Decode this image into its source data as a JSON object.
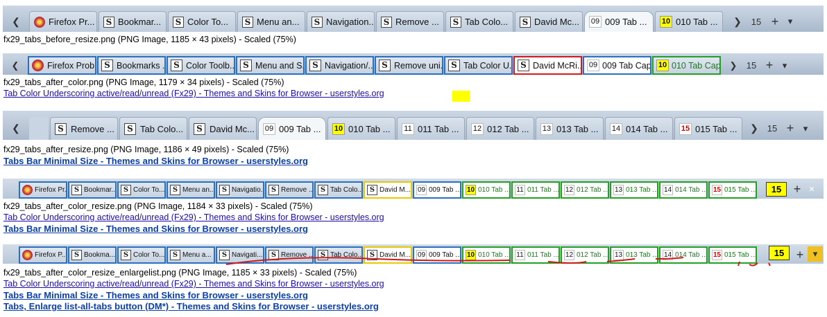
{
  "screens": [
    {
      "caption": "fx29_tabs_before_resize.png (PNG Image, 1185 × 43 pixels) - Scaled (75%)",
      "count": "15",
      "tabs": [
        {
          "label": "Firefox Pr...",
          "icon": "firefox-icon"
        },
        {
          "label": "Bookmar...",
          "icon": "userstyles-s-icon"
        },
        {
          "label": "Color To...",
          "icon": "userstyles-s-icon"
        },
        {
          "label": "Menu an...",
          "icon": "userstyles-s-icon"
        },
        {
          "label": "Navigation...",
          "icon": "userstyles-s-icon"
        },
        {
          "label": "Remove ...",
          "icon": "userstyles-s-icon"
        },
        {
          "label": "Tab Colo...",
          "icon": "userstyles-s-icon"
        },
        {
          "label": "David Mc...",
          "icon": "userstyles-s-icon"
        },
        {
          "label": "009 Tab ...",
          "num": "09"
        },
        {
          "label": "010 Tab ...",
          "num": "10"
        }
      ]
    },
    {
      "caption": "fx29_tabs_after_color.png (PNG Image, 1179 × 34 pixels) - Scaled (75%)",
      "link": "Tab Color Underscoring active/read/unread (Fx29) - Themes and Skins for Browser - userstyles.org",
      "count": "15",
      "tabs": [
        {
          "label": "Firefox Prob...",
          "icon": "firefox-icon"
        },
        {
          "label": "Bookmarks ...",
          "icon": "userstyles-s-icon"
        },
        {
          "label": "Color Toolb...",
          "icon": "userstyles-s-icon"
        },
        {
          "label": "Menu and S...",
          "icon": "userstyles-s-icon"
        },
        {
          "label": "Navigation/...",
          "icon": "userstyles-s-icon"
        },
        {
          "label": "Remove uni...",
          "icon": "userstyles-s-icon"
        },
        {
          "label": "Tab Color U...",
          "icon": "userstyles-s-icon"
        },
        {
          "label": "David McRi...",
          "icon": "userstyles-s-icon"
        },
        {
          "label": "009 Tab Cap...",
          "num": "09"
        },
        {
          "label": "010 Tab Cap...",
          "num": "10"
        }
      ]
    },
    {
      "caption": "fx29_tabs_after_resize.png (PNG Image, 1186 × 49 pixels) - Scaled (75%)",
      "link": "Tabs Bar Minimal Size - Themes and Skins for Browser - userstyles.org",
      "count": "15",
      "tabs": [
        {
          "label": "Remove ...",
          "icon": "userstyles-s-icon"
        },
        {
          "label": "Tab Colo...",
          "icon": "userstyles-s-icon"
        },
        {
          "label": "David Mc...",
          "icon": "userstyles-s-icon"
        },
        {
          "label": "009 Tab ...",
          "num": "09"
        },
        {
          "label": "010 Tab ...",
          "num": "10"
        },
        {
          "label": "011 Tab ...",
          "num": "11"
        },
        {
          "label": "012 Tab ...",
          "num": "12"
        },
        {
          "label": "013 Tab ...",
          "num": "13"
        },
        {
          "label": "014 Tab ...",
          "num": "14"
        },
        {
          "label": "015 Tab ...",
          "num": "15"
        }
      ]
    },
    {
      "caption": "fx29_tabs_after_color_resize.png (PNG Image, 1184 × 33 pixels) - Scaled (75%)",
      "links": [
        "Tab Color Underscoring active/read/unread (Fx29) - Themes and Skins for Browser - userstyles.org",
        "Tabs Bar Minimal Size - Themes and Skins for Browser - userstyles.org"
      ],
      "count": "15",
      "tabs": [
        {
          "label": "Firefox Pr...",
          "icon": "firefox-icon"
        },
        {
          "label": "Bookmar...",
          "icon": "userstyles-s-icon"
        },
        {
          "label": "Color To...",
          "icon": "userstyles-s-icon"
        },
        {
          "label": "Menu an...",
          "icon": "userstyles-s-icon"
        },
        {
          "label": "Navigatio...",
          "icon": "userstyles-s-icon"
        },
        {
          "label": "Remove ...",
          "icon": "userstyles-s-icon"
        },
        {
          "label": "Tab Colo...",
          "icon": "userstyles-s-icon"
        },
        {
          "label": "David M...",
          "icon": "userstyles-s-icon"
        },
        {
          "label": "009 Tab ...",
          "num": "09"
        },
        {
          "label": "010 Tab ...",
          "num": "10"
        },
        {
          "label": "011 Tab ...",
          "num": "11"
        },
        {
          "label": "012 Tab ...",
          "num": "12"
        },
        {
          "label": "013 Tab ...",
          "num": "13"
        },
        {
          "label": "014 Tab ...",
          "num": "14"
        },
        {
          "label": "015 Tab ...",
          "num": "15"
        }
      ]
    },
    {
      "caption": "fx29_tabs_after_color_resize_enlargelist.png (PNG Image, 1185 × 33 pixels) - Scaled (75%)",
      "links": [
        "Tab Color Underscoring active/read/unread (Fx29) - Themes and Skins for Browser - userstyles.org",
        "Tabs Bar Minimal Size - Themes and Skins for Browser - userstyles.org",
        "Tabs, Enlarge list-all-tabs button (DM*) - Themes and Skins for Browser - userstyles.org"
      ],
      "count": "15",
      "tabs": [
        {
          "label": "Firefox P...",
          "icon": "firefox-icon"
        },
        {
          "label": "Bookma...",
          "icon": "userstyles-s-icon"
        },
        {
          "label": "Color To...",
          "icon": "userstyles-s-icon"
        },
        {
          "label": "Menu a...",
          "icon": "userstyles-s-icon"
        },
        {
          "label": "Navigati...",
          "icon": "userstyles-s-icon"
        },
        {
          "label": "Remove ...",
          "icon": "userstyles-s-icon"
        },
        {
          "label": "Tab Colo...",
          "icon": "userstyles-s-icon"
        },
        {
          "label": "David M...",
          "icon": "userstyles-s-icon"
        },
        {
          "label": "009 Tab ...",
          "num": "09"
        },
        {
          "label": "010 Tab ...",
          "num": "10"
        },
        {
          "label": "011 Tab ...",
          "num": "11"
        },
        {
          "label": "012 Tab ...",
          "num": "12"
        },
        {
          "label": "013 Tab ...",
          "num": "13"
        },
        {
          "label": "014 Tab ...",
          "num": "14"
        },
        {
          "label": "015 Tab ...",
          "num": "15"
        }
      ]
    }
  ],
  "controls": {
    "scroll_left": "❮",
    "scroll_right": "❯",
    "new_tab": "+",
    "list_all": "▾",
    "close": "✕"
  },
  "colors": {
    "active_border": "#d21818",
    "read_border": "#2a6fc0",
    "unread_border": "#22a022",
    "highlight_yellow": "#ffff00",
    "link": "#1a0dab"
  }
}
